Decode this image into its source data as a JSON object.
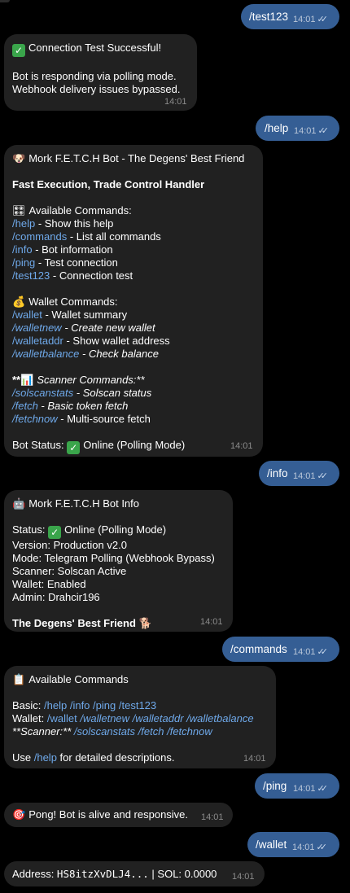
{
  "messages": {
    "m1": {
      "text": "/test123",
      "time": "14:01"
    },
    "m2": {
      "title": "Connection Test Successful!",
      "line1": "Bot is responding via polling mode.",
      "line2": "Webhook delivery issues bypassed.",
      "time": "14:01"
    },
    "m3": {
      "text": "/help",
      "time": "14:01"
    },
    "m4": {
      "title": "Mork F.E.T.C.H Bot - The Degens' Best Friend",
      "subtitle": "Fast Execution, Trade Control Handler",
      "available_header": "Available Commands:",
      "cmds": [
        {
          "cmd": "/help",
          "desc": " - Show this help"
        },
        {
          "cmd": "/commands",
          "desc": " - List all commands"
        },
        {
          "cmd": "/info",
          "desc": " - Bot information"
        },
        {
          "cmd": "/ping",
          "desc": " - Test connection"
        },
        {
          "cmd": "/test123",
          "desc": " - Connection test"
        }
      ],
      "wallet_header": "Wallet Commands:",
      "wallet_cmds": [
        {
          "cmd": "/wallet",
          "desc": " - Wallet summary"
        },
        {
          "cmd": "/walletnew",
          "desc": " - Create new wallet"
        },
        {
          "cmd": "/walletaddr",
          "desc": " - Show wallet address"
        },
        {
          "cmd": "/walletbalance",
          "desc": " - Check balance"
        }
      ],
      "scanner_prefix": "**",
      "scanner_header": "Scanner Commands:**",
      "scanner_cmds": [
        {
          "cmd": "/solscanstats",
          "desc": " - Solscan status"
        },
        {
          "cmd": "/fetch",
          "desc": " - Basic token fetch"
        },
        {
          "cmd": "/fetchnow",
          "desc": " - Multi-source fetch"
        }
      ],
      "status_label": "Bot Status:",
      "status_value": "Online (Polling Mode)",
      "time": "14:01"
    },
    "m5": {
      "text": "/info",
      "time": "14:01"
    },
    "m6": {
      "title": "Mork F.E.T.C.H Bot Info",
      "status_label": "Status:",
      "status_value": "Online (Polling Mode)",
      "version": "Version: Production v2.0",
      "mode": "Mode: Telegram Polling (Webhook Bypass)",
      "scanner": "Scanner: Solscan Active",
      "wallet": "Wallet: Enabled",
      "admin": "Admin: Drahcir196",
      "footer": "The Degens' Best Friend",
      "time": "14:01"
    },
    "m7": {
      "text": "/commands",
      "time": "14:01"
    },
    "m8": {
      "title": "Available Commands",
      "basic_label": "Basic: ",
      "basic_cmds": [
        "/help",
        "/info",
        "/ping",
        "/test123"
      ],
      "wallet_label": "Wallet: ",
      "wallet_cmds": [
        "/wallet",
        "/walletnew",
        "/walletaddr",
        "/walletbalance"
      ],
      "scanner_label": "**Scanner:** ",
      "scanner_cmds": [
        "/solscanstats",
        "/fetch",
        "/fetchnow"
      ],
      "use_pre": "Use ",
      "use_cmd": "/help",
      "use_post": " for detailed descriptions.",
      "time": "14:01"
    },
    "m9": {
      "text": "/ping",
      "time": "14:01"
    },
    "m10": {
      "text": "Pong! Bot is alive and responsive.",
      "time": "14:01"
    },
    "m11": {
      "text": "/wallet",
      "time": "14:01"
    },
    "m12": {
      "label": "Address: ",
      "address": "HS8itzXvDLJ4...",
      "sol": " | SOL: 0.0000",
      "time": "14:01"
    }
  },
  "icons": {
    "check": "check-mark-button-icon",
    "dog": "dog-face-icon",
    "remote": "remote-control-icon",
    "moneybag": "money-bag-icon",
    "chart": "bar-chart-icon",
    "robot": "robot-icon",
    "clipboard": "clipboard-icon",
    "target": "direct-hit-icon",
    "dog2": "dog-icon",
    "read": "double-check-read-icon"
  },
  "colors": {
    "outgoing_bubble": "#355e94",
    "incoming_bubble": "#212121",
    "command_link": "#6fa9ea",
    "background": "#000000"
  }
}
